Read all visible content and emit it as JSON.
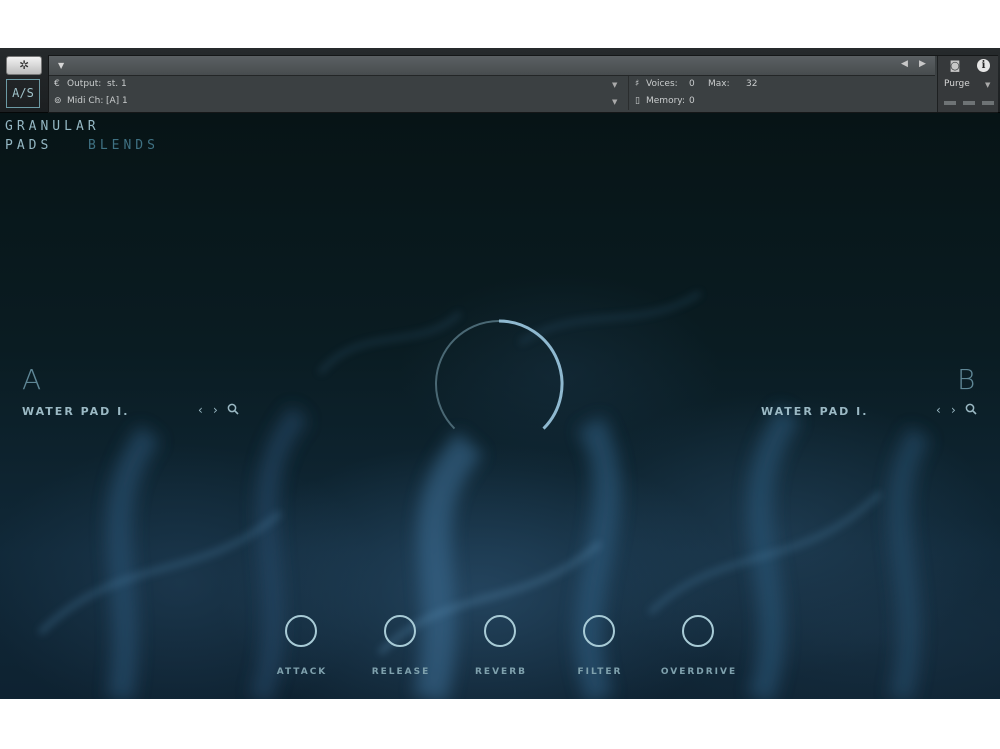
{
  "header": {
    "gear_glyph": "✲",
    "as_label": "A/S",
    "output_label": "Output:",
    "output_value": "st. 1",
    "midi_label": "Midi Ch:",
    "midi_value": "[A]  1",
    "voices_label": "Voices:",
    "voices_value": "0",
    "max_label": "Max:",
    "max_value": "32",
    "memory_label": "Memory:",
    "memory_value": "0",
    "purge_label": "Purge"
  },
  "brand": {
    "line1": "GRANULAR",
    "line2": "PADS",
    "line3": "BLENDS"
  },
  "slot_a": {
    "letter": "A",
    "patch": "WATER PAD I."
  },
  "slot_b": {
    "letter": "B",
    "patch": "WATER PAD I."
  },
  "blend": {
    "value": 0.5
  },
  "knobs": [
    {
      "label": "ATTACK"
    },
    {
      "label": "RELEASE"
    },
    {
      "label": "REVERB"
    },
    {
      "label": "FILTER"
    },
    {
      "label": "OVERDRIVE"
    }
  ],
  "colors": {
    "background": "#08171a",
    "accent": "#8fb9d0",
    "text": "#9bb9c4"
  }
}
